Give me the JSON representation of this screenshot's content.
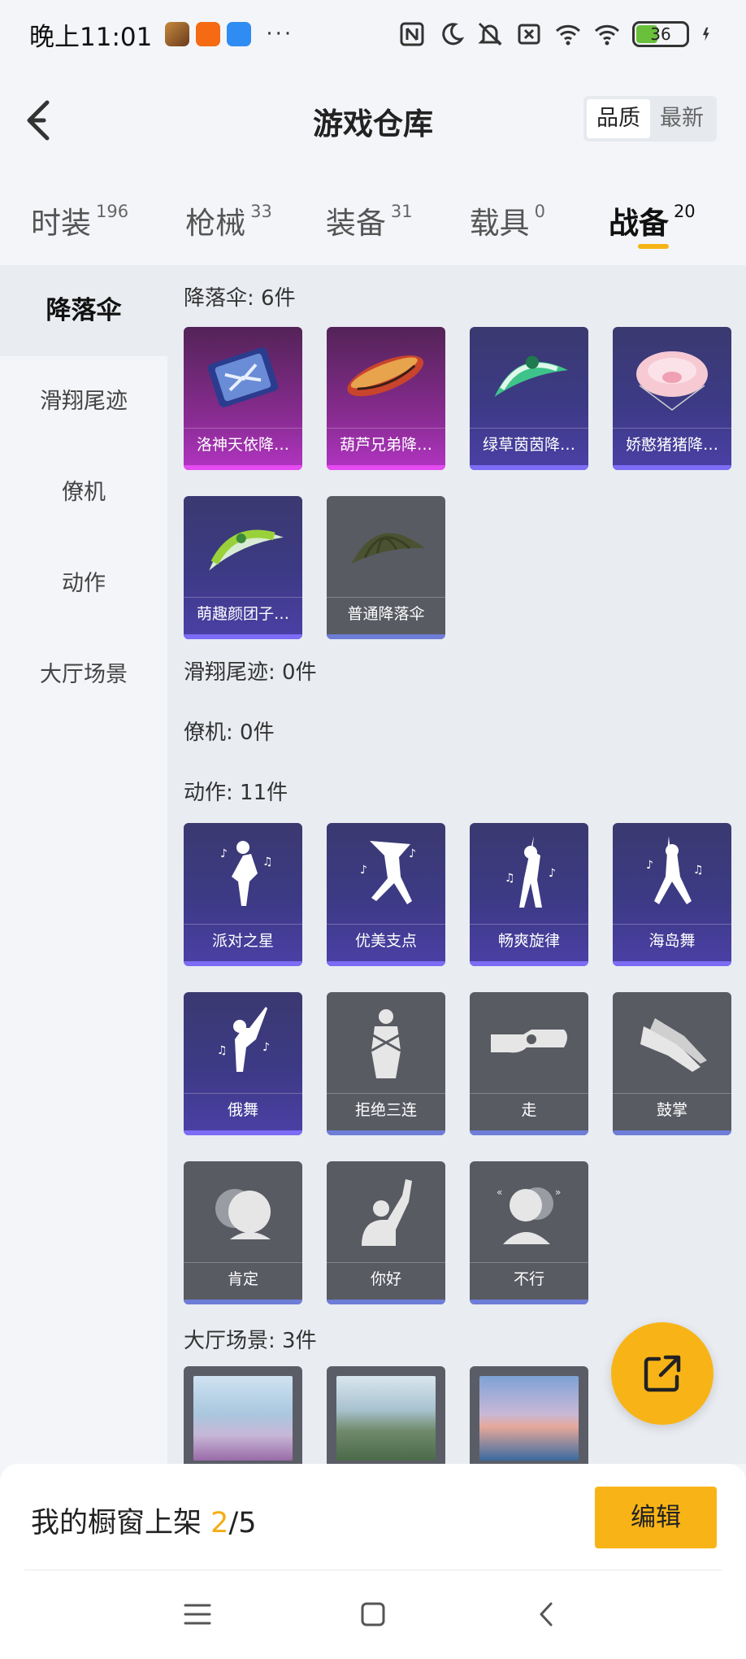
{
  "status_bar": {
    "time": "晚上11:01",
    "dots": "···",
    "battery": "36"
  },
  "header": {
    "title": "游戏仓库",
    "sort_options": [
      "品质",
      "最新"
    ]
  },
  "tabs": [
    {
      "label": "时装",
      "count": "196"
    },
    {
      "label": "枪械",
      "count": "33"
    },
    {
      "label": "装备",
      "count": "31"
    },
    {
      "label": "载具",
      "count": "0"
    },
    {
      "label": "战备",
      "count": "20"
    }
  ],
  "sidebar": [
    "降落伞",
    "滑翔尾迹",
    "僚机",
    "动作",
    "大厅场景"
  ],
  "sections": {
    "parachute_title": "降落伞: 6件",
    "glide_title": "滑翔尾迹: 0件",
    "wingman_title": "僚机: 0件",
    "action_title": "动作: 11件",
    "scene_title": "大厅场景: 3件"
  },
  "parachutes": [
    "洛神天依降…",
    "葫芦兄弟降…",
    "绿草茵茵降…",
    "娇憨猪猪降…",
    "萌趣颜团子…",
    "普通降落伞"
  ],
  "actions": [
    "派对之星",
    "优美支点",
    "畅爽旋律",
    "海岛舞",
    "俄舞",
    "拒绝三连",
    "走",
    "鼓掌",
    "肯定",
    "你好",
    "不行"
  ],
  "shelf": {
    "label": "我的橱窗上架",
    "current": "2",
    "total": "/5",
    "edit_label": "编辑"
  },
  "colors": {
    "accent": "#f8b417",
    "rare_purple": "#3d3a86",
    "epic_pink": "#8a2c93",
    "common_gray": "#595b63"
  }
}
